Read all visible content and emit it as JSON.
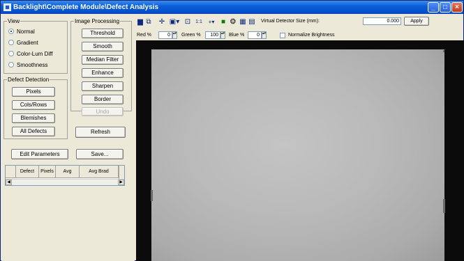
{
  "window": {
    "title": "Backlight\\Complete Module\\Defect Analysis",
    "controls": {
      "minimize": "_",
      "maximize": "□",
      "close": "×"
    }
  },
  "left_panel": {
    "view": {
      "label": "View",
      "options": [
        {
          "label": "Normal",
          "selected": true
        },
        {
          "label": "Gradient",
          "selected": false
        },
        {
          "label": "Color-Lum Diff",
          "selected": false
        },
        {
          "label": "Smoothness",
          "selected": false
        }
      ]
    },
    "image_processing": {
      "label": "Image Processing",
      "buttons": [
        "Threshold",
        "Smooth",
        "Median Filter",
        "Enhance",
        "Sharpen",
        "Border",
        "Undo"
      ]
    },
    "defect_detection": {
      "label": "Defect Detection",
      "buttons": [
        "Pixels",
        "Cols/Rows",
        "Blemishes",
        "All Defects"
      ]
    },
    "refresh_label": "Refresh",
    "edit_parameters_label": "Edit Parameters",
    "save_label": "Save...",
    "defect_table": {
      "columns": [
        "",
        "Defect",
        "Pixels",
        "Avg",
        "Avg Brad"
      ],
      "rows": []
    }
  },
  "toolbar": {
    "icons": [
      "save-icon",
      "copy-icon",
      "crosshair-icon",
      "window-dropdown-icon",
      "single-pixel-icon",
      "one-to-one-icon",
      "zoom-icon",
      "green-square-icon",
      "palette-icon",
      "chart-icon",
      "histogram-icon"
    ],
    "icon_glyphs": [
      "▆",
      "⧉",
      "✛",
      "▣▾",
      "⊡",
      "1:1",
      "+▾",
      "■",
      "❂",
      "▦",
      "▤"
    ],
    "virtual_detector_label": "Virtual Detector Size (mm):",
    "virtual_detector_value": "0.000",
    "apply_label": "Apply",
    "red_label": "Red %",
    "red_value": "0",
    "green_label": "Green %",
    "green_value": "100",
    "blue_label": "Blue %",
    "blue_value": "0",
    "normalize_label": "Normalize Brightness",
    "normalize_checked": false
  }
}
